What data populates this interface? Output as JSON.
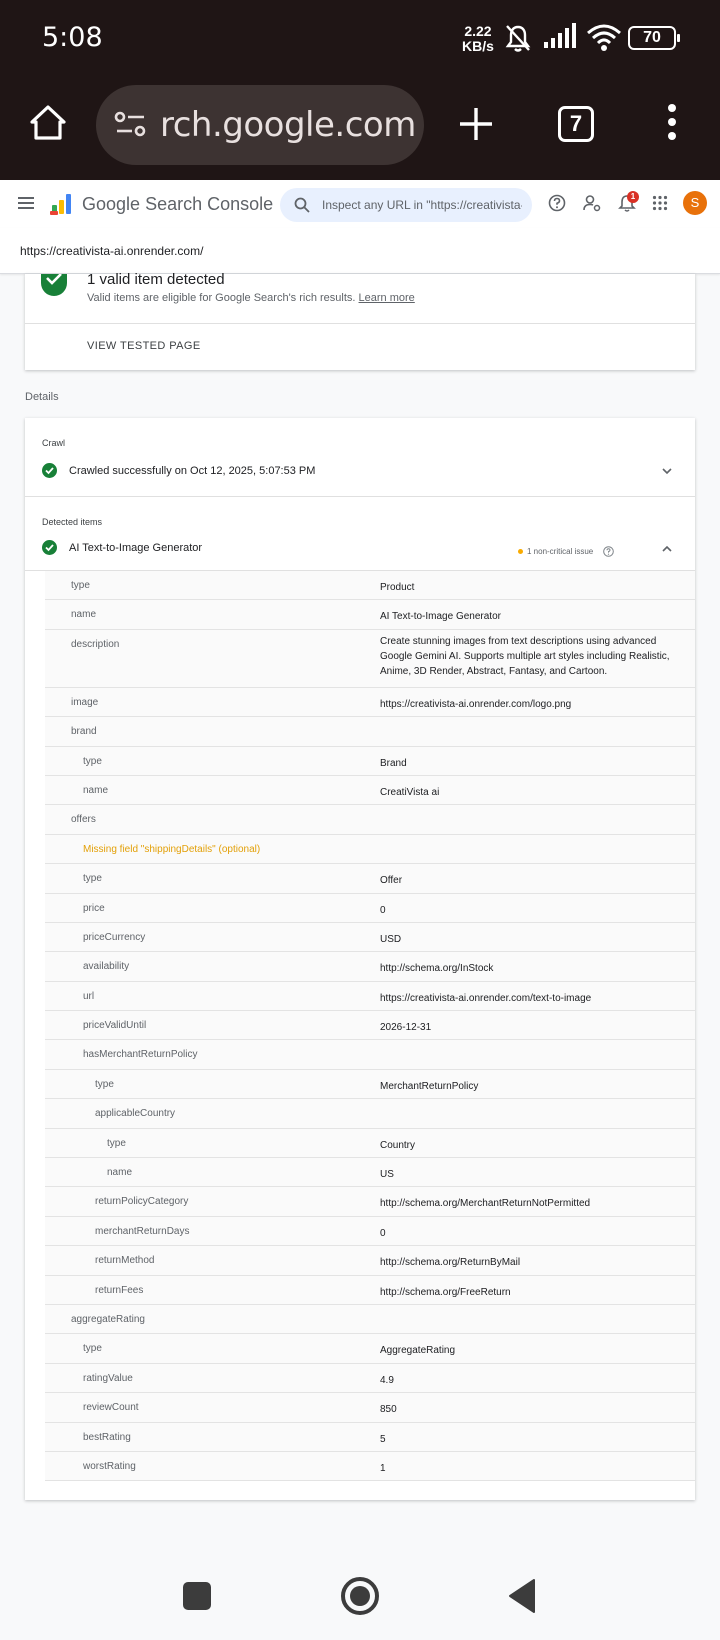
{
  "status_bar": {
    "time": "5:08",
    "net_speed_value": "2.22",
    "net_speed_unit": "KB/s",
    "battery": "70"
  },
  "browser": {
    "url_display": "rch.google.com",
    "tab_count": "7"
  },
  "app": {
    "title_google": "Google",
    "title_product": "Search Console",
    "search_placeholder": "Inspect any URL in \"https://creativista-ai.onrender.com/\"",
    "notification_count": "1",
    "avatar_letter": "S",
    "property_url": "https://creativista-ai.onrender.com/"
  },
  "summary": {
    "title": "1 valid item detected",
    "subtitle": "Valid items are eligible for Google Search's rich results.",
    "learn_more": "Learn more",
    "view_tested_page": "VIEW TESTED PAGE"
  },
  "details": {
    "label": "Details",
    "crawl_label": "Crawl",
    "crawl_status": "Crawled successfully on Oct 12, 2025, 5:07:53 PM",
    "detected_label": "Detected items",
    "item_name": "AI Text-to-Image Generator",
    "issue_text": "1 non-critical issue"
  },
  "rows": [
    {
      "key": "type",
      "value": "Product",
      "indent": 0
    },
    {
      "key": "name",
      "value": "AI Text-to-Image Generator",
      "indent": 0
    },
    {
      "key": "description",
      "value": "Create stunning images from text descriptions using advanced Google Gemini AI. Supports multiple art styles including Realistic, Anime, 3D Render, Abstract, Fantasy, and Cartoon.",
      "indent": 0
    },
    {
      "key": "image",
      "value": "https://creativista-ai.onrender.com/logo.png",
      "indent": 0
    },
    {
      "key": "brand",
      "value": "",
      "indent": 0
    },
    {
      "key": "type",
      "value": "Brand",
      "indent": 1
    },
    {
      "key": "name",
      "value": "CreatiVista ai",
      "indent": 1
    },
    {
      "key": "offers",
      "value": "",
      "indent": 0
    },
    {
      "key": "Missing field \"shippingDetails\" (optional)",
      "value": "",
      "indent": 1,
      "warning": true
    },
    {
      "key": "type",
      "value": "Offer",
      "indent": 1
    },
    {
      "key": "price",
      "value": "0",
      "indent": 1
    },
    {
      "key": "priceCurrency",
      "value": "USD",
      "indent": 1
    },
    {
      "key": "availability",
      "value": "http://schema.org/InStock",
      "indent": 1
    },
    {
      "key": "url",
      "value": "https://creativista-ai.onrender.com/text-to-image",
      "indent": 1
    },
    {
      "key": "priceValidUntil",
      "value": "2026-12-31",
      "indent": 1
    },
    {
      "key": "hasMerchantReturnPolicy",
      "value": "",
      "indent": 1
    },
    {
      "key": "type",
      "value": "MerchantReturnPolicy",
      "indent": 2
    },
    {
      "key": "applicableCountry",
      "value": "",
      "indent": 2
    },
    {
      "key": "type",
      "value": "Country",
      "indent": 3
    },
    {
      "key": "name",
      "value": "US",
      "indent": 3
    },
    {
      "key": "returnPolicyCategory",
      "value": "http://schema.org/MerchantReturnNotPermitted",
      "indent": 2
    },
    {
      "key": "merchantReturnDays",
      "value": "0",
      "indent": 2
    },
    {
      "key": "returnMethod",
      "value": "http://schema.org/ReturnByMail",
      "indent": 2
    },
    {
      "key": "returnFees",
      "value": "http://schema.org/FreeReturn",
      "indent": 2
    },
    {
      "key": "aggregateRating",
      "value": "",
      "indent": 0
    },
    {
      "key": "type",
      "value": "AggregateRating",
      "indent": 1
    },
    {
      "key": "ratingValue",
      "value": "4.9",
      "indent": 1
    },
    {
      "key": "reviewCount",
      "value": "850",
      "indent": 1
    },
    {
      "key": "bestRating",
      "value": "5",
      "indent": 1
    },
    {
      "key": "worstRating",
      "value": "1",
      "indent": 1
    }
  ],
  "colors": {
    "status_bar_bg": "#1f1515",
    "success_green": "#188038",
    "warning_amber": "#e3a008",
    "avatar_orange": "#e8710a",
    "search_bg": "#e8f0fe"
  }
}
